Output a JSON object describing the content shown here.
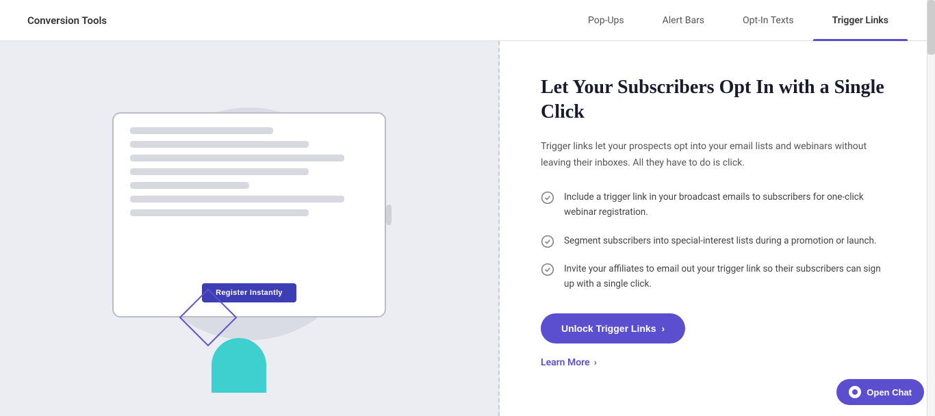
{
  "header": {
    "logo": "Conversion Tools",
    "nav_items": [
      {
        "label": "Pop-Ups",
        "active": false
      },
      {
        "label": "Alert Bars",
        "active": false
      },
      {
        "label": "Opt-In Texts",
        "active": false
      },
      {
        "label": "Trigger Links",
        "active": true
      }
    ]
  },
  "feature": {
    "title": "Let Your Subscribers Opt In with a Single Click",
    "description": "Trigger links let your prospects opt into your email lists and webinars without leaving their inboxes. All they have to do is click.",
    "list_items": [
      {
        "text": "Include a trigger link in your broadcast emails to subscribers for one-click webinar registration."
      },
      {
        "text": "Segment subscribers into special-interest lists during a promotion or launch."
      },
      {
        "text": "Invite your affiliates to email out your trigger link so their subscribers can sign up with a single click."
      }
    ],
    "unlock_button": "Unlock Trigger Links",
    "learn_more": "Learn More"
  },
  "illustration": {
    "tablet_button": "Register Instantly"
  },
  "chat": {
    "label": "Open Chat"
  },
  "icons": {
    "chevron_right": "›",
    "check_circle": "✓"
  }
}
